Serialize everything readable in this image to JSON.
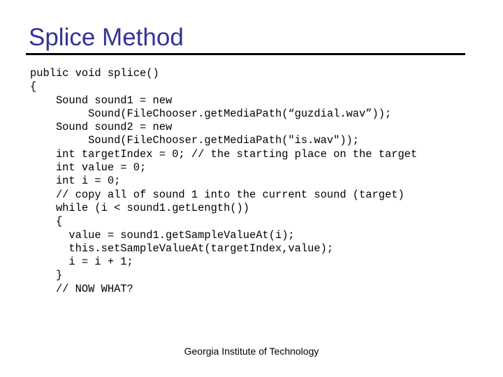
{
  "slide": {
    "title": "Splice Method",
    "footer": "Georgia Institute of Technology",
    "colors": {
      "title": "#333399",
      "rule": "#000000",
      "text": "#000000",
      "background": "#ffffff"
    }
  },
  "code": {
    "language": "java",
    "lines": [
      "public void splice()",
      "{",
      "    Sound sound1 = new",
      "         Sound(FileChooser.getMediaPath(“guzdial.wav”));",
      "    Sound sound2 = new",
      "         Sound(FileChooser.getMediaPath(\"is.wav\"));",
      "    int targetIndex = 0; // the starting place on the target",
      "    int value = 0;",
      "    int i = 0;",
      "    // copy all of sound 1 into the current sound (target)",
      "    while (i < sound1.getLength())",
      "    {",
      "      value = sound1.getSampleValueAt(i);",
      "      this.setSampleValueAt(targetIndex,value);",
      "      i = i + 1;",
      "    }",
      "    // NOW WHAT?"
    ]
  }
}
